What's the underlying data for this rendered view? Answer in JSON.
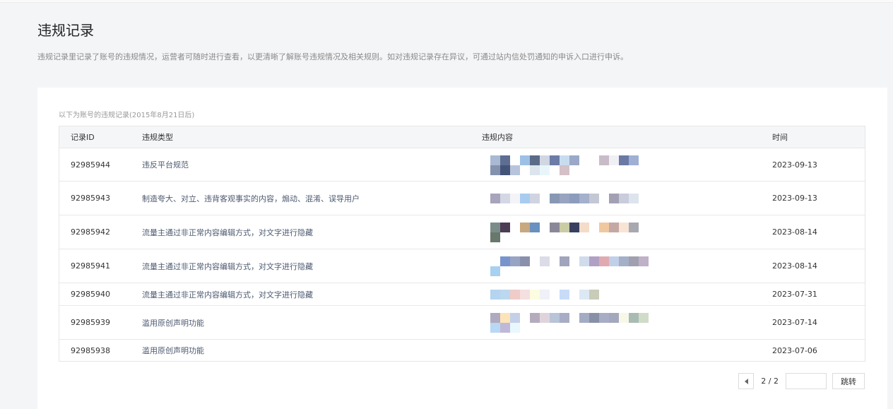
{
  "page": {
    "title": "违规记录",
    "description": "违规记录里记录了账号的违规情况，运营者可随时进行查看，以更清晰了解账号违规情况及相关规则。如对违规记录存在异议，可通过站内信处罚通知的申诉入口进行申诉。"
  },
  "table": {
    "caption": "以下为账号的违规记录(2015年8月21日后)",
    "headers": {
      "id": "记录ID",
      "type": "违规类型",
      "content": "违规内容",
      "time": "时间"
    },
    "rows": [
      {
        "id": "92985944",
        "type": "违反平台规范",
        "time": "2023-09-13",
        "mosaic": [
          "#a9b9d4",
          "#5e6e92",
          "#ffffff",
          "#9dc0e6",
          "#5b6b87",
          "#d0d6e2",
          "#6b7da6",
          "#c8dcf0",
          "#9aa9c8",
          "#ffffff",
          "#ffffff",
          "#c8bcc8",
          "#f0f0f4",
          "#6a7aa4",
          "#a0b0d4",
          "#ffffff",
          "#8592ae",
          "#445478",
          "#b8c4dc",
          "#ffffff",
          "#dce4ee",
          "#e8f6fa",
          "#ffffff",
          "#d4c0c8"
        ]
      },
      {
        "id": "92985943",
        "type": "制造夸大、对立、违背客观事实的内容，煽动、混淆、误导用户",
        "time": "2023-09-13",
        "mosaic": [
          "#a8a4bc",
          "#d4d8e4",
          "#f4f4f8",
          "#a8ccf0",
          "#d0d4e0",
          "#ffffff",
          "#8898b4",
          "#98a4c0",
          "#8c9cbc",
          "#a4b0cc",
          "#c4c8d4",
          "#ffffff",
          "#a4a0b4",
          "#c8ccdc",
          "#dde4ee",
          "#ffffff"
        ]
      },
      {
        "id": "92985942",
        "type": "流量主通过非正常内容编辑方式，对文字进行隐藏",
        "time": "2023-08-14",
        "mosaic": [
          "#7a8c88",
          "#4c3c54",
          "#ffffff",
          "#c8a880",
          "#6890c0",
          "#ffffff",
          "#8a8898",
          "#cacca4",
          "#384060",
          "#f4dcc8",
          "#ffffff",
          "#f0c8a0",
          "#c4a8a4",
          "#f8e4d4",
          "#a8a8b0",
          "#ffffff",
          "#68786c"
        ]
      },
      {
        "id": "92985941",
        "type": "流量主通过非正常内容编辑方式，对文字进行隐藏",
        "time": "2023-08-14",
        "mosaic": [
          "#ffffff",
          "#7894cc",
          "#98a4c4",
          "#8890ac",
          "#ffffff",
          "#dcdce8",
          "#ffffff",
          "#a0a4bc",
          "#ffffff",
          "#d0dcec",
          "#b0a0c4",
          "#e0aab0",
          "#c0d0e8",
          "#a4b0c8",
          "#a0a0b0",
          "#c0b0c8",
          "#a8d0f0"
        ]
      },
      {
        "id": "92985940",
        "type": "流量主通过非正常内容编辑方式，对文字进行隐藏",
        "time": "2023-07-31",
        "mosaic": [
          "#b4d4f0",
          "#bcd8f0",
          "#f0ccc8",
          "#f4e0e0",
          "#fcfce0",
          "#f0f0f8",
          "#ffffff",
          "#c8dcf8",
          "#ffffff",
          "#dce8f4",
          "#c8ccb8",
          "#ffffff"
        ]
      },
      {
        "id": "92985939",
        "type": "滥用原创声明功能",
        "time": "2023-07-14",
        "mosaic": [
          "#b0aac0",
          "#fce4b8",
          "#c4d0e8",
          "#ffffff",
          "#b4acbc",
          "#e0d4dc",
          "#b8c4d8",
          "#a8acc4",
          "#ffffff",
          "#a4acc4",
          "#8890a8",
          "#a8acc4",
          "#a4a8bc",
          "#f8f8e8",
          "#a8bcb4",
          "#d0dcc8",
          "#b8d8f4",
          "#c0b8d8",
          "#e8f8fc"
        ]
      },
      {
        "id": "92985938",
        "type": "滥用原创声明功能",
        "time": "2023-07-06",
        "mosaic": []
      }
    ]
  },
  "pager": {
    "info": "2 / 2",
    "input_value": "",
    "jump_label": "跳转",
    "prev_icon": "caret-left-icon"
  }
}
